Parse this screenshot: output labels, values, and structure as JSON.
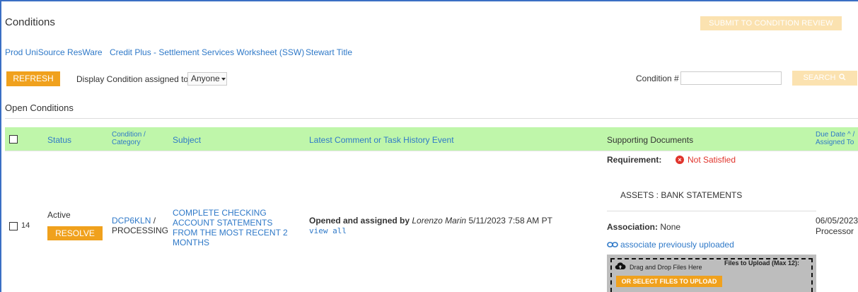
{
  "header": {
    "title": "Conditions",
    "submit_label": "SUBMIT TO CONDITION REVIEW"
  },
  "vendor_links": [
    "Prod UniSource ResWare",
    "Credit Plus - Settlement Services Worksheet (SSW)",
    "Stewart Title"
  ],
  "toolbar": {
    "refresh_label": "REFRESH",
    "display_label": "Display Condition assigned to:",
    "assigned_value": "Anyone",
    "condition_label": "Condition #",
    "condition_value": "",
    "search_label": "SEARCH"
  },
  "section_title": "Open Conditions",
  "table": {
    "headers": {
      "status": "Status",
      "condition_1": "Condition /",
      "condition_2": "Category",
      "subject": "Subject",
      "comment": "Latest Comment or Task History Event",
      "docs": "Supporting Documents",
      "due_1": "Due Date",
      "due_sort": "^",
      "due_slash": "/",
      "due_2": "Assigned To"
    },
    "rows": [
      {
        "number": "14",
        "status": "Active",
        "resolve_label": "RESOLVE",
        "condition_code": "DCP6KLN",
        "condition_sep": " /",
        "category": "PROCESSING",
        "subject": "COMPLETE CHECKING ACCOUNT STATEMENTS FROM THE MOST RECENT 2 MONTHS",
        "comment_prefix": "Opened and assigned by",
        "comment_user": "Lorenzo Marin",
        "comment_date": "5/11/2023 7:58 AM PT",
        "view_all": "view all",
        "requirement_label": "Requirement:",
        "requirement_status": "Not Satisfied",
        "document_type": "ASSETS : BANK STATEMENTS",
        "association_label": "Association:",
        "association_value": "None",
        "associate_link": "associate previously uploaded",
        "drag_text": "Drag and Drop Files Here",
        "files_text": "Files to Upload (Max 12):",
        "select_files": "OR SELECT FILES TO UPLOAD",
        "due_date": "06/05/2023",
        "assigned_to": "Processor"
      }
    ]
  },
  "colors": {
    "accent": "#f0a11d",
    "accent_disabled": "#fbe2b0",
    "link": "#2f79c8",
    "header_bg": "#bff6aa",
    "error": "#e0342c"
  }
}
